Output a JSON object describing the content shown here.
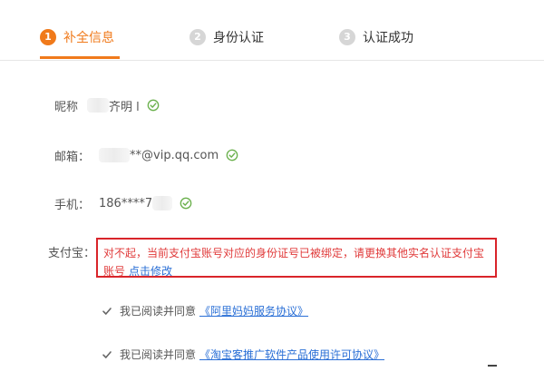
{
  "steps": [
    {
      "num": "1",
      "label": "补全信息"
    },
    {
      "num": "2",
      "label": "身份认证"
    },
    {
      "num": "3",
      "label": "认证成功"
    }
  ],
  "form": {
    "nickname": {
      "label": "昵称",
      "value": "齐明 l"
    },
    "email": {
      "label": "邮箱：",
      "value": "**@vip.qq.com"
    },
    "phone": {
      "label": "手机：",
      "value": "186****7"
    },
    "alipay": {
      "label": "支付宝：",
      "error": "对不起，当前支付宝账号对应的身份证号已被绑定，请更换其他实名认证支付宝账号",
      "link": "点击修改"
    }
  },
  "agreements": [
    {
      "text": "我已阅读并同意",
      "link": "《阿里妈妈服务协议》"
    },
    {
      "text": "我已阅读并同意",
      "link": "《淘宝客推广软件产品使用许可协议》"
    }
  ],
  "colors": {
    "accent": "#f07a1b",
    "error": "#d9242a",
    "link": "#2a6fd6",
    "success": "#6ab04c"
  }
}
